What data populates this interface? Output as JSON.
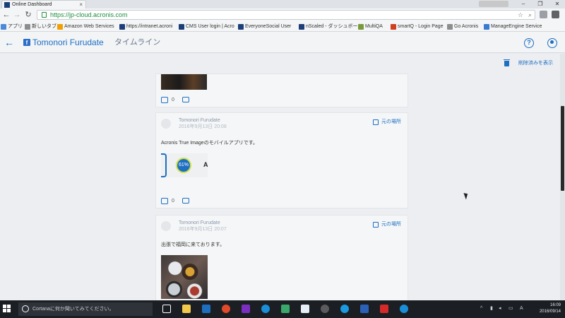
{
  "browser": {
    "tab_title": "Online Dashboard",
    "tab_close": "×",
    "profile_chip": "",
    "url": "https://jp-cloud.acronis.com",
    "window_controls": [
      "‒",
      "❐",
      "✕"
    ],
    "bookmarks": [
      {
        "label": "アプリ",
        "color": "#4a8ad8"
      },
      {
        "label": "新しいタブ",
        "color": "#8d8d8d"
      },
      {
        "label": "Amazon Web Services",
        "color": "#f0a000"
      },
      {
        "label": "https://intranet.acroni",
        "color": "#1c3f7a"
      },
      {
        "label": "CMS User login | Acro",
        "color": "#1c3f7a"
      },
      {
        "label": "EveryoneSocial User",
        "color": "#1c3f7a"
      },
      {
        "label": "nScaled - ダッシュボード",
        "color": "#1c3f7a"
      },
      {
        "label": "MultiQA",
        "color": "#7a9a3a"
      },
      {
        "label": "smartQ - Login Page",
        "color": "#d04020"
      },
      {
        "label": "Go Acronis",
        "color": "#8d8d8d"
      },
      {
        "label": "ManageEngine Service",
        "color": "#3a7ad0"
      }
    ]
  },
  "header": {
    "back_icon": "←",
    "account_name": "Tomonori Furudate",
    "section_tab": "タイムライン",
    "help_label": "?"
  },
  "toolbar": {
    "delete_label": "削除済みを表示"
  },
  "posts": [
    {
      "likes": "0"
    },
    {
      "author": "Tomonori Furudate",
      "timestamp": "2016年9月13日 20:08",
      "origin_label": "元の場所",
      "text": "Acronis True Imageのモバイルアプリです。",
      "preview_badge": "61%",
      "preview_letter": "A",
      "likes": "0"
    },
    {
      "author": "Tomonori Furudate",
      "timestamp": "2016年9月13日 20:07",
      "origin_label": "元の場所",
      "text": "出張で福岡に来ております。"
    }
  ],
  "taskbar": {
    "search_text": "Cortanaに何か聞いてみてください。",
    "tray_lang": "A",
    "time": "16:09",
    "date": "2016/09/14",
    "pinned_colors": [
      "#ffffff",
      "#f2c94c",
      "#1f6fbf",
      "#e04a2a",
      "#7b2fbf",
      "#1a8fd8",
      "#3aa86b",
      "#5b5b5b",
      "#e8eef5",
      "#1a9ae0",
      "#2b62b8",
      "#d42a2a",
      "#1a8fd8"
    ]
  }
}
